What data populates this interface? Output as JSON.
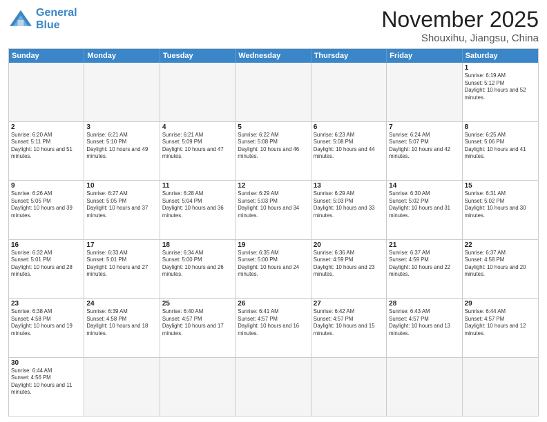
{
  "logo": {
    "line1": "General",
    "line2": "Blue"
  },
  "title": "November 2025",
  "location": "Shouxihu, Jiangsu, China",
  "days_of_week": [
    "Sunday",
    "Monday",
    "Tuesday",
    "Wednesday",
    "Thursday",
    "Friday",
    "Saturday"
  ],
  "weeks": [
    [
      {
        "day": "",
        "empty": true
      },
      {
        "day": "",
        "empty": true
      },
      {
        "day": "",
        "empty": true
      },
      {
        "day": "",
        "empty": true
      },
      {
        "day": "",
        "empty": true
      },
      {
        "day": "",
        "empty": true
      },
      {
        "day": "1",
        "sunrise": "6:19 AM",
        "sunset": "5:12 PM",
        "daylight": "10 hours and 52 minutes."
      }
    ],
    [
      {
        "day": "2",
        "sunrise": "6:20 AM",
        "sunset": "5:11 PM",
        "daylight": "10 hours and 51 minutes."
      },
      {
        "day": "3",
        "sunrise": "6:21 AM",
        "sunset": "5:10 PM",
        "daylight": "10 hours and 49 minutes."
      },
      {
        "day": "4",
        "sunrise": "6:21 AM",
        "sunset": "5:09 PM",
        "daylight": "10 hours and 47 minutes."
      },
      {
        "day": "5",
        "sunrise": "6:22 AM",
        "sunset": "5:08 PM",
        "daylight": "10 hours and 46 minutes."
      },
      {
        "day": "6",
        "sunrise": "6:23 AM",
        "sunset": "5:08 PM",
        "daylight": "10 hours and 44 minutes."
      },
      {
        "day": "7",
        "sunrise": "6:24 AM",
        "sunset": "5:07 PM",
        "daylight": "10 hours and 42 minutes."
      },
      {
        "day": "8",
        "sunrise": "6:25 AM",
        "sunset": "5:06 PM",
        "daylight": "10 hours and 41 minutes."
      }
    ],
    [
      {
        "day": "9",
        "sunrise": "6:26 AM",
        "sunset": "5:05 PM",
        "daylight": "10 hours and 39 minutes."
      },
      {
        "day": "10",
        "sunrise": "6:27 AM",
        "sunset": "5:05 PM",
        "daylight": "10 hours and 37 minutes."
      },
      {
        "day": "11",
        "sunrise": "6:28 AM",
        "sunset": "5:04 PM",
        "daylight": "10 hours and 36 minutes."
      },
      {
        "day": "12",
        "sunrise": "6:29 AM",
        "sunset": "5:03 PM",
        "daylight": "10 hours and 34 minutes."
      },
      {
        "day": "13",
        "sunrise": "6:29 AM",
        "sunset": "5:03 PM",
        "daylight": "10 hours and 33 minutes."
      },
      {
        "day": "14",
        "sunrise": "6:30 AM",
        "sunset": "5:02 PM",
        "daylight": "10 hours and 31 minutes."
      },
      {
        "day": "15",
        "sunrise": "6:31 AM",
        "sunset": "5:02 PM",
        "daylight": "10 hours and 30 minutes."
      }
    ],
    [
      {
        "day": "16",
        "sunrise": "6:32 AM",
        "sunset": "5:01 PM",
        "daylight": "10 hours and 28 minutes."
      },
      {
        "day": "17",
        "sunrise": "6:33 AM",
        "sunset": "5:01 PM",
        "daylight": "10 hours and 27 minutes."
      },
      {
        "day": "18",
        "sunrise": "6:34 AM",
        "sunset": "5:00 PM",
        "daylight": "10 hours and 26 minutes."
      },
      {
        "day": "19",
        "sunrise": "6:35 AM",
        "sunset": "5:00 PM",
        "daylight": "10 hours and 24 minutes."
      },
      {
        "day": "20",
        "sunrise": "6:36 AM",
        "sunset": "4:59 PM",
        "daylight": "10 hours and 23 minutes."
      },
      {
        "day": "21",
        "sunrise": "6:37 AM",
        "sunset": "4:59 PM",
        "daylight": "10 hours and 22 minutes."
      },
      {
        "day": "22",
        "sunrise": "6:37 AM",
        "sunset": "4:58 PM",
        "daylight": "10 hours and 20 minutes."
      }
    ],
    [
      {
        "day": "23",
        "sunrise": "6:38 AM",
        "sunset": "4:58 PM",
        "daylight": "10 hours and 19 minutes."
      },
      {
        "day": "24",
        "sunrise": "6:39 AM",
        "sunset": "4:58 PM",
        "daylight": "10 hours and 18 minutes."
      },
      {
        "day": "25",
        "sunrise": "6:40 AM",
        "sunset": "4:57 PM",
        "daylight": "10 hours and 17 minutes."
      },
      {
        "day": "26",
        "sunrise": "6:41 AM",
        "sunset": "4:57 PM",
        "daylight": "10 hours and 16 minutes."
      },
      {
        "day": "27",
        "sunrise": "6:42 AM",
        "sunset": "4:57 PM",
        "daylight": "10 hours and 15 minutes."
      },
      {
        "day": "28",
        "sunrise": "6:43 AM",
        "sunset": "4:57 PM",
        "daylight": "10 hours and 13 minutes."
      },
      {
        "day": "29",
        "sunrise": "6:44 AM",
        "sunset": "4:57 PM",
        "daylight": "10 hours and 12 minutes."
      }
    ],
    [
      {
        "day": "30",
        "sunrise": "6:44 AM",
        "sunset": "4:56 PM",
        "daylight": "10 hours and 11 minutes."
      },
      {
        "day": "",
        "empty": true
      },
      {
        "day": "",
        "empty": true
      },
      {
        "day": "",
        "empty": true
      },
      {
        "day": "",
        "empty": true
      },
      {
        "day": "",
        "empty": true
      },
      {
        "day": "",
        "empty": true
      }
    ]
  ]
}
